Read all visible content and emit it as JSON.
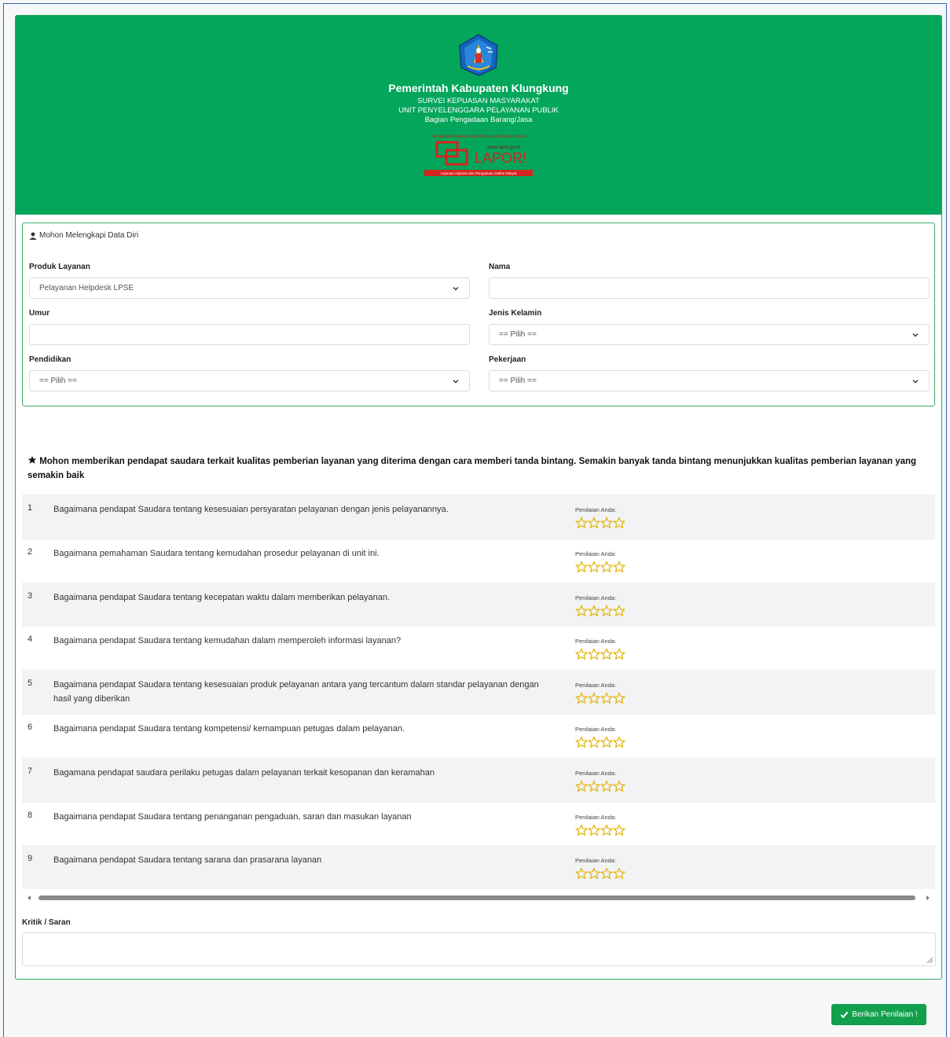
{
  "header": {
    "title": "Pemerintah Kabupaten Klungkung",
    "subtitle_lines": [
      "SURVEI KEPUASAN MASYARAKAT",
      "UNIT PENYELENGGARA PELAYANAN PUBLIK",
      "Bagian Pengadaan Barang/Jasa"
    ],
    "lapor_tagline": "Sampaikan Aspirasi dan Pengaduan Anda Melalui",
    "lapor_url": "www.lapor.go.id",
    "lapor_brand": "LAPOR!",
    "lapor_footer": "Layanan Aspirasi dan Pengaduan Online Rakyat",
    "colors": {
      "header_bg": "#03a65a",
      "lapor_red": "#d42420"
    }
  },
  "personal": {
    "heading": "Mohon Melengkapi Data Diri",
    "heading_icon": "user-icon",
    "produk_label": "Produk Layanan",
    "produk_value": "Pelayanan Helpdesk LPSE",
    "nama_label": "Nama",
    "nama_value": "",
    "umur_label": "Umur",
    "umur_value": "",
    "jenis_label": "Jenis Kelamin",
    "jenis_value": "== Pilih ==",
    "pendidikan_label": "Pendidikan",
    "pendidikan_value": "== Pilih ==",
    "pekerjaan_label": "Pekerjaan",
    "pekerjaan_value": "== Pilih =="
  },
  "rating": {
    "intro": "Mohon memberikan pendapat saudara terkait kualitas pemberian layanan yang diterima dengan cara memberi tanda bintang. Semakin banyak tanda bintang menunjukkan kualitas pemberian layanan yang semakin baik",
    "intro_icon": "star-icon",
    "rate_label": "Penilaian Anda:",
    "star_color": "#e4b81a",
    "questions": [
      {
        "num": "1",
        "text": "Bagaimana pendapat Saudara tentang kesesuaian persyaratan pelayanan dengan jenis pelayanannya."
      },
      {
        "num": "2",
        "text": "Bagaimana pemahaman Saudara tentang kemudahan prosedur pelayanan di unit ini."
      },
      {
        "num": "3",
        "text": "Bagaimana pendapat Saudara tentang kecepatan waktu dalam memberikan pelayanan."
      },
      {
        "num": "4",
        "text": "Bagaimana pendapat Saudara tentang kemudahan dalam memperoleh informasi layanan?"
      },
      {
        "num": "5",
        "text": "Bagaimana pendapat Saudara tentang kesesuaian produk pelayanan antara yang tercantum dalam standar pelayanan dengan hasil yang diberikan"
      },
      {
        "num": "6",
        "text": "Bagaimana pendapat Saudara tentang kompetensi/ kemampuan petugas dalam pelayanan."
      },
      {
        "num": "7",
        "text": "Bagamana pendapat saudara perilaku petugas dalam pelayanan terkait kesopanan dan keramahan"
      },
      {
        "num": "8",
        "text": "Bagaimana pendapat Saudara tentang penanganan pengaduan, saran dan masukan layanan"
      },
      {
        "num": "9",
        "text": "Bagaimana pendapat Saudara tentang sarana dan prasarana layanan"
      }
    ]
  },
  "kritik": {
    "label": "Kritik / Saran",
    "value": ""
  },
  "submit": {
    "label": "Berikan Penilaian !",
    "icon": "check-icon",
    "color": "#13a04d"
  }
}
